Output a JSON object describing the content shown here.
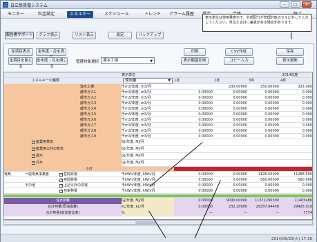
{
  "window": {
    "title": "日立受賃電システム",
    "min": "–",
    "max": "□",
    "close": "×"
  },
  "menu": [
    "モニター",
    "料金設定",
    "エネルギー",
    "スケジュール",
    "トレンド",
    "アラーム履歴",
    "設定",
    "会移",
    "終了"
  ],
  "menu_active_index": 2,
  "notice": "表示単位は使用量表示で、外部配分が管理対象のセルに外して入力してください。単位と合計に差異がある場合があります。",
  "toolbar": {
    "report": "報告書サポート",
    "graph": "グラフ表示",
    "list": "リスト表示",
    "settings": "設定",
    "backup": "バックアップ"
  },
  "controls": {
    "all_expand": "全項目表示",
    "all_year_month": "全年度・月を表示",
    "all_collapse": "全項目を閉じる",
    "year_month_close": "全年度・月を閉じる",
    "target_label": "管理対象選択",
    "target_value": "湊水工場",
    "print": "印刷",
    "csv": "CSV作成",
    "save": "保存",
    "table_print": "表示範囲印刷",
    "copy_input": "コピー入力",
    "refresh": "表示更新"
  },
  "table": {
    "energy_type": "エネルギーの種類",
    "display_unit": "表示単位",
    "unit_value": "使用量",
    "year": "2014年度",
    "months": [
      "1月",
      "2月",
      "3月",
      "4月"
    ],
    "rows": [
      {
        "label": "湊水工場",
        "unit": "千m3/年度, m3/月",
        "vals": [
          "",
          "200.00000",
          "250.00000",
          "325.000"
        ]
      },
      {
        "label": "都市ガス1",
        "unit": "千m3/年度, m3/月",
        "vals": [
          "0.00000",
          "0.00000",
          "0.00000",
          "0.000"
        ]
      },
      {
        "label": "都市ガス2",
        "unit": "千m3/年度, m3/月",
        "vals": [
          "0.00000",
          "0.00000",
          "0.00000",
          "0.000"
        ]
      },
      {
        "label": "都市ガス3",
        "unit": "千m3/年度, m3/月",
        "vals": [
          "0.00000",
          "0.00000",
          "0.00000",
          "0.000"
        ]
      },
      {
        "label": "都市ガス4",
        "unit": "千m3/年度, m3/月",
        "vals": [
          "0.00000",
          "0.00000",
          "0.00000",
          "0.000"
        ]
      },
      {
        "label": "都市ガス5",
        "unit": "千m3/年度, m3/月",
        "vals": [
          "0.00000",
          "0.00000",
          "0.00000",
          "0.000"
        ]
      },
      {
        "label": "都市ガス6",
        "unit": "千m3/年度, m3/月",
        "vals": [
          "0.00000",
          "0.00000",
          "0.00000",
          "0.000"
        ]
      },
      {
        "label": "都市ガス7",
        "unit": "千m3/年度, m3/月",
        "vals": [
          "0.00000",
          "0.00000",
          "0.00000",
          "0.000"
        ]
      },
      {
        "label": "都市ガス8",
        "unit": "千m3/年度, m3/月",
        "vals": [
          "0.00000",
          "0.00000",
          "0.00000",
          "0.000"
        ]
      },
      {
        "label": "都市ガス9",
        "unit": "千m3/年度, m3/月",
        "vals": [
          "0.00000",
          "0.00000",
          "0.00000",
          "0.000"
        ]
      }
    ],
    "groups": [
      {
        "label": "産業用蒸気",
        "unit": "GJ/年度, MJ/月"
      },
      {
        "label": "産業用以外の蒸気",
        "unit": "GJ/年度, MJ/月"
      },
      {
        "label": "温水",
        "unit": "GJ/年度, MJ/月"
      },
      {
        "label": "冷水",
        "unit": "GJ/年度, MJ/月"
      }
    ],
    "subtotal_label": "小計",
    "electric": {
      "category": "電気",
      "sub1": "一般電気事業者",
      "sub2": "その他",
      "rows": [
        {
          "label": "昼間買電",
          "unit": "千kWh/年度, kWh/月",
          "vals": [
            "0.00000",
            "0.00000",
            "1128.50000",
            "11288.500"
          ]
        },
        {
          "label": "夜間買電",
          "unit": "千kWh/年度, kWh/月",
          "vals": [
            "0.00000",
            "0.00000",
            "560.00000",
            "560.000"
          ]
        },
        {
          "label": "上記以外の買電",
          "unit": "千kWh/年度, kWh/月",
          "vals": [
            "0.00000",
            "0.00000",
            "0.00000",
            "0.000"
          ]
        },
        {
          "label": "自家発電",
          "unit": "千kWh/年度, kWh/月",
          "vals": [
            "0.00000",
            "0.00000",
            "0.00000",
            "0.000"
          ]
        }
      ]
    },
    "totals": [
      {
        "label": "合計熱量",
        "unit": "GJ/年度, MJ/月",
        "vals": [
          "0.00000",
          "9000.00000",
          "11371290300",
          "11405480"
        ]
      },
      {
        "label": "合計熱量(原油換算)",
        "unit": "kL/年度, kL/月",
        "vals": [
          "0.00000",
          "232.20000",
          "29337.94458",
          "29425.019"
        ]
      },
      {
        "label": "合計熱量(前年度比率)",
        "unit": "%",
        "vals": [
          "—",
          "—",
          "—",
          "7774"
        ]
      }
    ]
  },
  "status": {
    "timestamp": "2014/05/20(火) 17:36"
  },
  "colors": {
    "accent": "#1f4e8f",
    "group": "#f6c79e",
    "highlight": "#c8232f",
    "electric": "#83c25b",
    "total": "#7b5aa6"
  }
}
